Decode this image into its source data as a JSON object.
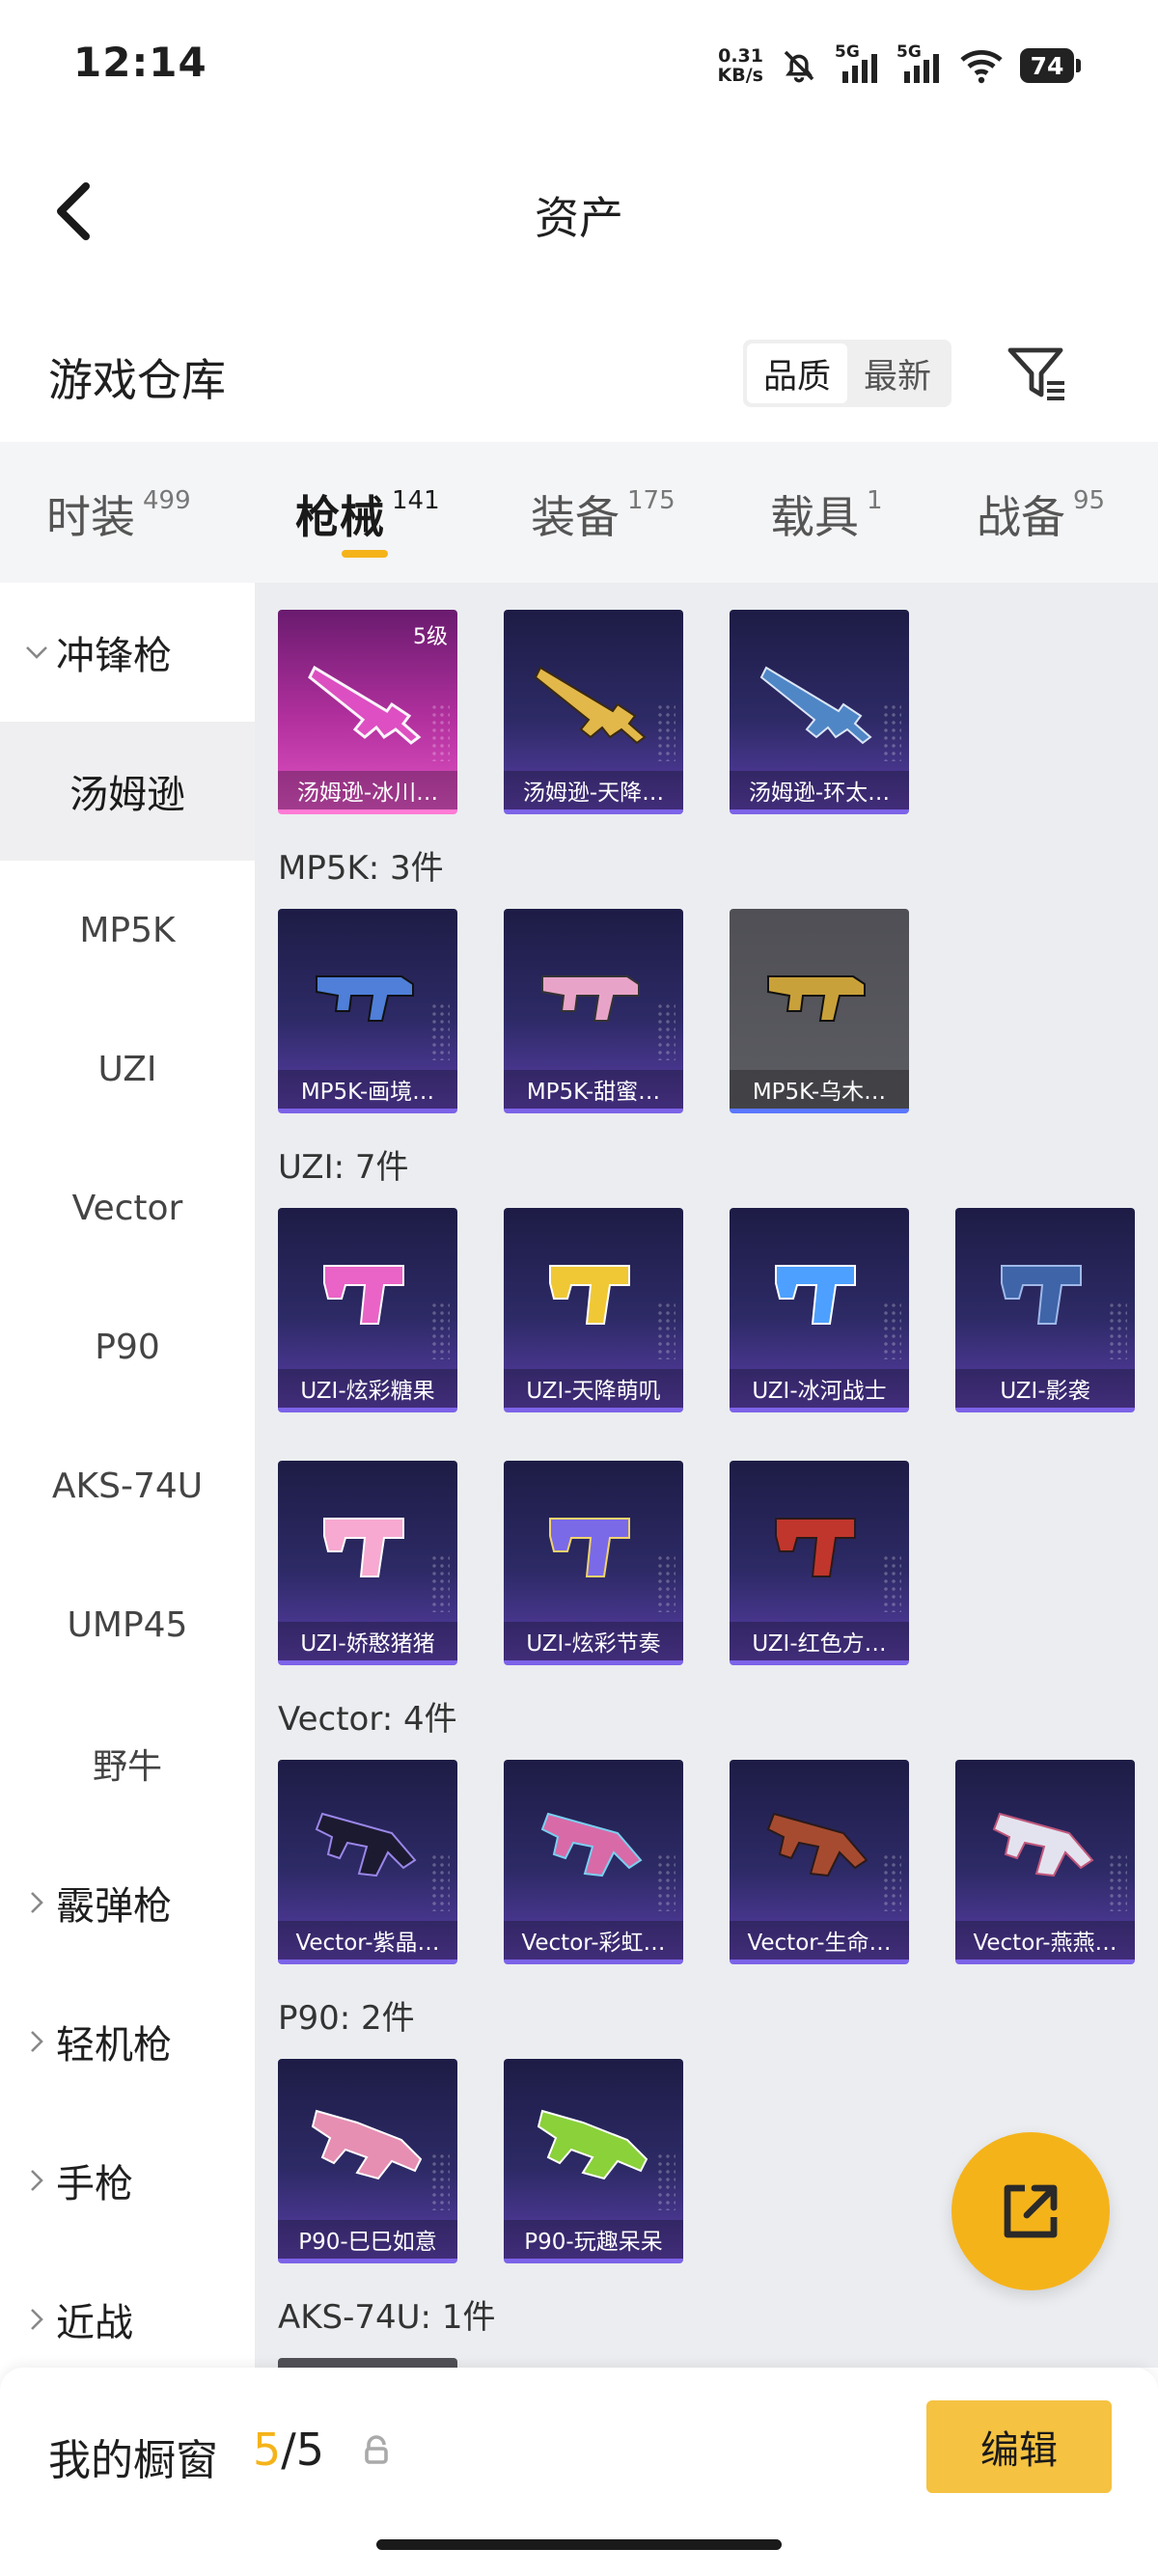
{
  "status_bar": {
    "time": "12:14",
    "speed_value": "0.31",
    "speed_unit": "KB/s",
    "network_1": "5G",
    "network_2": "5G",
    "battery": "74"
  },
  "header": {
    "title": "资产"
  },
  "warehouse": {
    "title": "游戏仓库",
    "sort_options": [
      "品质",
      "最新"
    ],
    "sort_selected": "品质"
  },
  "tabs": [
    {
      "label": "时装",
      "count": "499"
    },
    {
      "label": "枪械",
      "count": "141"
    },
    {
      "label": "装备",
      "count": "175"
    },
    {
      "label": "载具",
      "count": "1"
    },
    {
      "label": "战备",
      "count": "95"
    }
  ],
  "sidebar": {
    "categories": {
      "smg": "冲锋枪",
      "shotgun": "霰弹枪",
      "lmg": "轻机枪",
      "pistol": "手枪",
      "melee": "近战"
    },
    "smg_items": [
      "汤姆逊",
      "MP5K",
      "UZI",
      "Vector",
      "P90",
      "AKS-74U",
      "UMP45",
      "野牛"
    ]
  },
  "groups": {
    "mp5k": "MP5K: 3件",
    "uzi": "UZI: 7件",
    "vector": "Vector: 4件",
    "p90": "P90: 2件",
    "aks": "AKS-74U: 1件"
  },
  "items": {
    "thompson": [
      {
        "name": "汤姆逊-冰川…",
        "level": "5级",
        "color": "#e052c4"
      },
      {
        "name": "汤姆逊-天降…",
        "color": "#e3b84a"
      },
      {
        "name": "汤姆逊-环太…",
        "color": "#4f86c6"
      }
    ],
    "mp5k": [
      {
        "name": "MP5K-画境…",
        "color": "#4f7fd9"
      },
      {
        "name": "MP5K-甜蜜…",
        "color": "#e8a4c8"
      },
      {
        "name": "MP5K-乌木…",
        "color": "#c9a13a"
      }
    ],
    "uzi": [
      {
        "name": "UZI-炫彩糖果",
        "color": "#ea63c6"
      },
      {
        "name": "UZI-天降萌叽",
        "color": "#f0c836"
      },
      {
        "name": "UZI-冰河战士",
        "color": "#4da0ff"
      },
      {
        "name": "UZI-影袭",
        "color": "#3f64a8"
      },
      {
        "name": "UZI-娇憨猪猪",
        "color": "#f7a9d1"
      },
      {
        "name": "UZI-炫彩节奏",
        "color": "#7a6ae8"
      },
      {
        "name": "UZI-红色方…",
        "color": "#c0362c"
      }
    ],
    "vector": [
      {
        "name": "Vector-紫晶…",
        "color": "#1c1a30"
      },
      {
        "name": "Vector-彩虹…",
        "color": "#d96aa8"
      },
      {
        "name": "Vector-生命…",
        "color": "#a64b30"
      },
      {
        "name": "Vector-燕燕…",
        "color": "#e3e3ef"
      }
    ],
    "p90": [
      {
        "name": "P90-巳巳如意",
        "color": "#e68fb3"
      },
      {
        "name": "P90-玩趣呆呆",
        "color": "#8ad13a"
      }
    ]
  },
  "cabinet": {
    "title": "我的橱窗",
    "used": "5",
    "separator": "/",
    "total": "5",
    "edit_label": "编辑"
  }
}
